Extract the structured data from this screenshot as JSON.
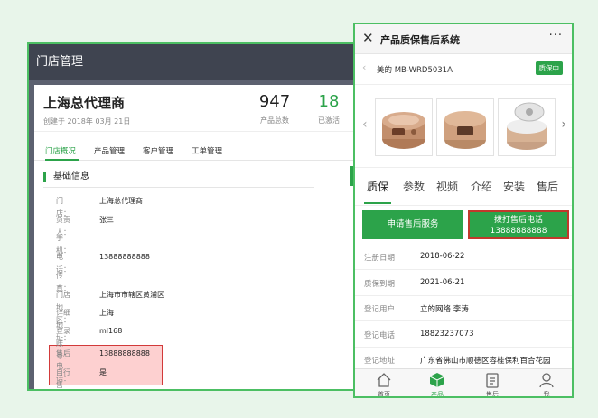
{
  "admin": {
    "title": "门店管理",
    "store_name": "上海总代理商",
    "created": "创建于 2018年 03月 21日",
    "stats": [
      {
        "value": "947",
        "label": "产品总数"
      },
      {
        "value": "18",
        "label": "已激活"
      }
    ],
    "tabs": [
      "门店概况",
      "产品管理",
      "客户管理",
      "工单管理"
    ],
    "active_tab": "门店概况",
    "section_title": "基础信息",
    "fields": [
      {
        "label": "门店：",
        "value": "上海总代理商"
      },
      {
        "label": "负责人：",
        "value": "张三"
      },
      {
        "label": "手机：",
        "value": ""
      },
      {
        "label": "电话：",
        "value": "13888888888"
      },
      {
        "label": "传真：",
        "value": ""
      },
      {
        "label": "门店地区：",
        "value": "上海市市辖区黄浦区"
      },
      {
        "label": "详细地址：",
        "value": "上海"
      },
      {
        "label": "登录账号：",
        "value": "ml168"
      },
      {
        "label": "售后电话：",
        "value": "13888888888"
      },
      {
        "label": "自行售后：",
        "value": "是"
      }
    ]
  },
  "phone": {
    "title": "产品质保售后系统",
    "more": "···",
    "product_name": "美的 MB-WRD5031A",
    "status_badge": "质保中",
    "tabs": [
      "质保",
      "参数",
      "视频",
      "介绍",
      "安装",
      "售后"
    ],
    "active_tab": "质保",
    "apply_button": "申请售后服务",
    "call_button_line1": "拨打售后电话",
    "call_button_line2": "13888888888",
    "details": [
      {
        "label": "注册日期",
        "value": "2018-06-22"
      },
      {
        "label": "质保到期",
        "value": "2021-06-21"
      },
      {
        "label": "登记用户",
        "value": "立的网络 李涛"
      },
      {
        "label": "登记电话",
        "value": "18823237073"
      },
      {
        "label": "登记地址",
        "value": "广东省佛山市顺德区容桂保利百合花园"
      }
    ],
    "nav": [
      {
        "label": "首页",
        "icon": "home-icon"
      },
      {
        "label": "产品",
        "icon": "cube-icon"
      },
      {
        "label": "售后",
        "icon": "clipboard-icon"
      },
      {
        "label": "我",
        "icon": "user-icon"
      }
    ],
    "active_nav": "产品"
  },
  "colors": {
    "accent_green": "#2ca34a",
    "highlight_red": "#d23a3a",
    "highlight_fill": "#fdd0d0",
    "admin_dark": "#3f4450"
  }
}
